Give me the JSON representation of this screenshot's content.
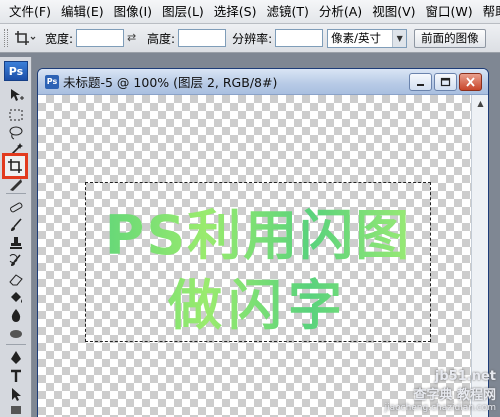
{
  "menu": [
    "文件(F)",
    "编辑(E)",
    "图像(I)",
    "图层(L)",
    "选择(S)",
    "滤镜(T)",
    "分析(A)",
    "视图(V)",
    "窗口(W)",
    "帮助"
  ],
  "options": {
    "width_label": "宽度:",
    "width_value": "",
    "height_label": "高度:",
    "height_value": "",
    "resolution_label": "分辨率:",
    "resolution_value": "",
    "unit_select": "像素/英寸",
    "front_image_button": "前面的图像"
  },
  "toolbox": {
    "logo": "Ps",
    "tools": [
      "move-icon",
      "marquee-icon",
      "lasso-icon",
      "magic-wand-icon",
      "crop-icon",
      "slice-icon",
      "healing-icon",
      "brush-icon",
      "clone-stamp-icon",
      "history-brush-icon",
      "eraser-icon",
      "paint-bucket-icon",
      "blur-icon",
      "dodge-icon",
      "pen-icon",
      "type-icon",
      "path-select-icon",
      "shape-icon"
    ],
    "active_tool": "crop-icon"
  },
  "document": {
    "title": "未标题-5 @ 100% (图层 2, RGB/8#)",
    "art_line1": "PS利用闪图",
    "art_line2": "做闪字"
  },
  "watermark": {
    "site": "查字典 教程网",
    "url": "jiaocheng.chazidian.com",
    "site_short": "jb51.net"
  },
  "colors": {
    "highlight": "#e23a1e",
    "text_green_start": "#5cd47a",
    "text_green_end": "#a6ee73"
  }
}
